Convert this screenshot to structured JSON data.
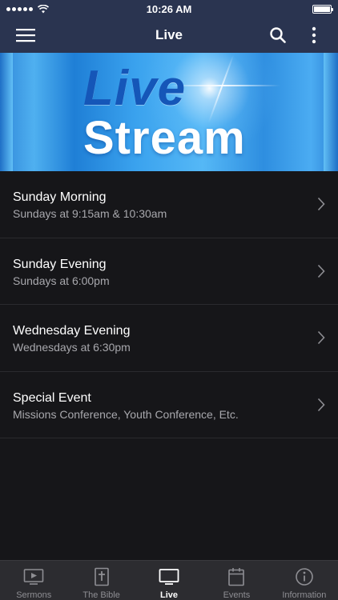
{
  "status_bar": {
    "time": "10:26 AM",
    "signal_icon": "signal-dots-icon",
    "wifi_icon": "wifi-icon",
    "battery_icon": "battery-icon"
  },
  "app_bar": {
    "title": "Live",
    "menu_icon": "hamburger-menu-icon",
    "search_icon": "search-icon",
    "more_icon": "more-vertical-icon",
    "background": "#2a3450"
  },
  "banner": {
    "line1": "Live",
    "line2": "Stream"
  },
  "items": [
    {
      "title": "Sunday Morning",
      "subtitle": "Sundays at 9:15am & 10:30am"
    },
    {
      "title": "Sunday Evening",
      "subtitle": "Sundays at 6:00pm"
    },
    {
      "title": "Wednesday Evening",
      "subtitle": "Wednesdays at 6:30pm"
    },
    {
      "title": "Special Event",
      "subtitle": "Missions Conference, Youth Conference, Etc."
    }
  ],
  "tabs": [
    {
      "label": "Sermons",
      "icon": "video-play-icon",
      "active": false
    },
    {
      "label": "The Bible",
      "icon": "bible-cross-icon",
      "active": false
    },
    {
      "label": "Live",
      "icon": "tv-monitor-icon",
      "active": true
    },
    {
      "label": "Events",
      "icon": "calendar-icon",
      "active": false
    },
    {
      "label": "Information",
      "icon": "info-circle-icon",
      "active": false
    }
  ],
  "colors": {
    "background": "#161619",
    "tab_bar": "#2c2c30",
    "subtitle": "#a8a8ad"
  }
}
